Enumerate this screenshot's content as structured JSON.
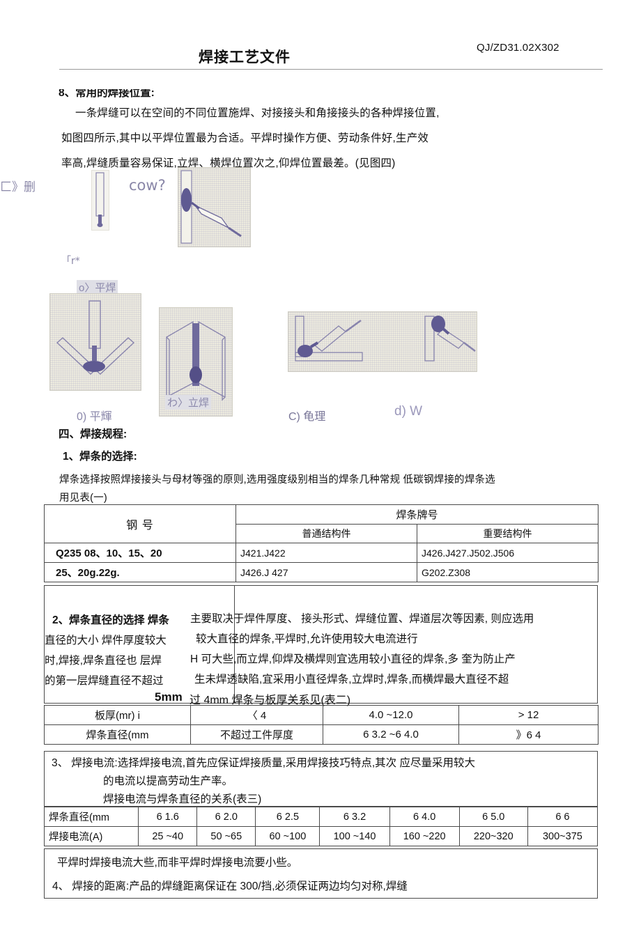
{
  "header": {
    "title": "焊接工艺文件",
    "doc_code": "QJ/ZD31.02X302"
  },
  "intro": {
    "heading": "8、常用的焊接位置:",
    "lines": [
      "一条焊缝可以在空间的不同位置施焊、对接接头和角接接头的各种焊接位置,",
      "如图四所示,其中以平焊位置最为合适。平焊时操作方便、劳动条件好,生产效",
      "率高,焊缝质量容易保证,立焊、横焊位置次之,仰焊位置最差。(见图四)"
    ]
  },
  "figures": {
    "stray_marks": [
      "匚》删",
      "cow?",
      "「r*"
    ],
    "captions": [
      "o〉平焊",
      "0) 平輝",
      "わ〉立焊",
      "C) 龟理",
      "d) W"
    ]
  },
  "section4": {
    "heading": "四、焊接规程:",
    "sub1_heading": "1、焊条的选择:",
    "sub1_lines": [
      "焊条选择按照焊接接头与母材等强的原则,选用强度级别相当的焊条几种常规 低碳钢焊接的焊条选",
      "用见表(一)"
    ]
  },
  "table1": {
    "col1_header": "钢                号",
    "col2_group_header": "焊条牌号",
    "col2_sub_a": "普通结构件",
    "col2_sub_b": "重要结构件",
    "rows": [
      {
        "steel": "Q235 08、10、15、20",
        "common": "J421.J422",
        "important": "J426.J427.J502.J506"
      },
      {
        "steel": "25、20g.22g.",
        "common": "J426.J 427",
        "important": "G202.Z308"
      }
    ]
  },
  "section2_block": {
    "left_lines": [
      "2、焊条直径的选择 焊条",
      "直径的大小 焊件厚度较大",
      "时,焊接,焊条直径也 层焊",
      "的第一层焊缝直径不超过",
      "5mm"
    ],
    "right_lines": [
      "主要取决于焊件厚度、 接头形式、焊缝位置、焊道层次等因素, 则应选用",
      "较大直径的焊条,平焊时,允许使用较大电流进行",
      "H 可大些,而立焊,仰焊及横焊则宜选用较小直径的焊条,多 奎为防止产",
      "生未焊透缺陷,宜采用小直径焊条,立焊时,焊条,而横焊最大直径不超",
      "过 4mm 焊条与板厚关系见(表二)"
    ]
  },
  "table2": {
    "row_headers": [
      "板厚(mr) i",
      "焊条直径(mm"
    ],
    "columns": [
      {
        "thickness": "〈 4",
        "diameter": "不超过工件厚度"
      },
      {
        "thickness": "4.0 ~12.0",
        "diameter": "6 3.2 ~6 4.0"
      },
      {
        "thickness": "> 12",
        "diameter": "》6 4"
      }
    ]
  },
  "section3": {
    "line1": "3、 焊接电流:选择焊接电流,首先应保证焊接质量,采用焊接技巧特点,其次 应尽量采用较大",
    "line2": "的电流以提高劳动生产率。",
    "table_caption": "焊接电流与焊条直径的关系(表三)"
  },
  "table3": {
    "row_headers": [
      "焊条直径(mm",
      "焊接电流(A)"
    ],
    "columns": [
      {
        "diameter": "6 1.6",
        "current": "25 ~40"
      },
      {
        "diameter": "6 2.0",
        "current": "50 ~65"
      },
      {
        "diameter": "6 2.5",
        "current": "60 ~100"
      },
      {
        "diameter": "6 3.2",
        "current": "100 ~140"
      },
      {
        "diameter": "6 4.0",
        "current": "160 ~220"
      },
      {
        "diameter": "6 5.0",
        "current": "220~320"
      },
      {
        "diameter": "6 6",
        "current": "300~375"
      }
    ]
  },
  "footer_notes": {
    "note1": "平焊时焊接电流大些,而非平焊时焊接电流要小些。",
    "note2": "4、 焊接的距离:产品的焊缝距离保证在 300/挡,必须保证两边均匀对称,焊缝"
  },
  "colors": {
    "ink": "#111111",
    "rule": "#4a4a4a",
    "scan_purple": "#8b88ab",
    "figure_bg": "#eceade"
  }
}
